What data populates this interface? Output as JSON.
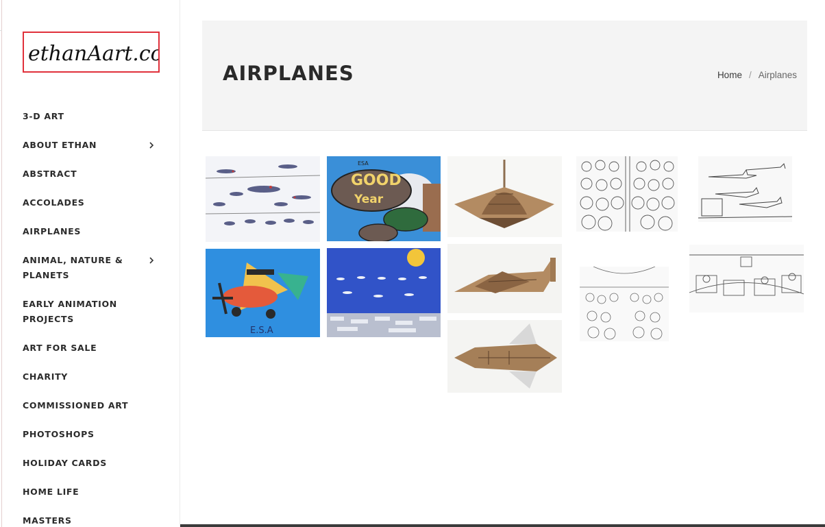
{
  "site": {
    "logo_text": "ethanAart.com"
  },
  "sidebar": {
    "items": [
      {
        "label": "3-D ART",
        "has_children": false
      },
      {
        "label": "ABOUT ETHAN",
        "has_children": true
      },
      {
        "label": "ABSTRACT",
        "has_children": false
      },
      {
        "label": "ACCOLADES",
        "has_children": false
      },
      {
        "label": "AIRPLANES",
        "has_children": false
      },
      {
        "label": "ANIMAL, NATURE & PLANETS",
        "has_children": true
      },
      {
        "label": "EARLY ANIMATION PROJECTS",
        "has_children": false
      },
      {
        "label": "ART FOR SALE",
        "has_children": false
      },
      {
        "label": "CHARITY",
        "has_children": false
      },
      {
        "label": "COMMISSIONED ART",
        "has_children": false
      },
      {
        "label": "PHOTOSHOPS",
        "has_children": false
      },
      {
        "label": "HOLIDAY CARDS",
        "has_children": false
      },
      {
        "label": "HOME LIFE",
        "has_children": false
      },
      {
        "label": "MASTERS",
        "has_children": false
      }
    ]
  },
  "header": {
    "title": "AIRPLANES",
    "breadcrumb": {
      "home": "Home",
      "separator": "/",
      "current": "Airplanes"
    }
  },
  "gallery": {
    "painting_text": {
      "good": "GOOD",
      "year": "Year",
      "esa_small": "ESA",
      "esa_signature": "E.S.A"
    }
  },
  "colors": {
    "logo_border": "#e0303a",
    "header_bg": "#f4f4f4",
    "nav_text": "#2b2b2b",
    "footer_bar": "#3b3b3b"
  }
}
